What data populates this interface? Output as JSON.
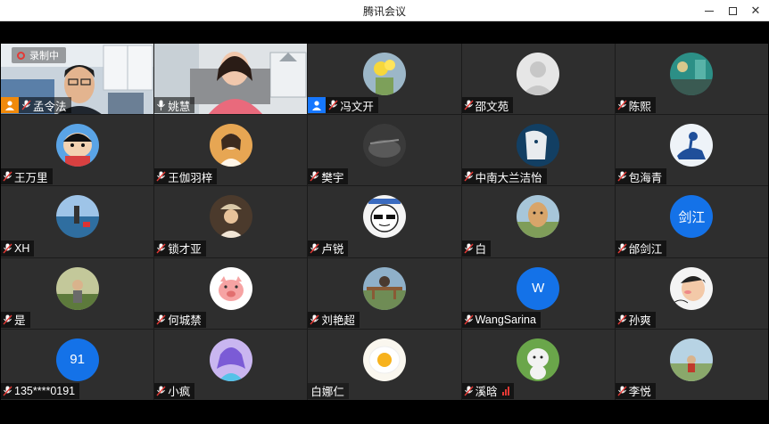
{
  "window": {
    "title": "腾讯会议",
    "minimize_icon": "minimize-icon",
    "maximize_icon": "maximize-icon",
    "close_icon": "close-icon",
    "close_glyph": "✕"
  },
  "recording": {
    "label": "录制中",
    "icon": "record-icon"
  },
  "colors": {
    "active_speaker_border": "#2fd05e",
    "host_badge": "#f08a0c",
    "cohost_badge": "#1677ff",
    "mic_muted": "#e53935",
    "text_avatar_bg": "#1472e8"
  },
  "participants": [
    {
      "name": "孟令法",
      "role": "host",
      "mic": "muted",
      "video": true
    },
    {
      "name": "姚慧",
      "mic": "on",
      "video": true,
      "active": true
    },
    {
      "name": "冯文开",
      "role": "cohost",
      "mic": "muted",
      "avatar": "daffodils-photo"
    },
    {
      "name": "邵文苑",
      "mic": "muted",
      "avatar": "default-avatar"
    },
    {
      "name": "陈熙",
      "mic": "muted",
      "avatar": "teal-scene-photo"
    },
    {
      "name": "王万里",
      "mic": "muted",
      "avatar": "cartoon-boy"
    },
    {
      "name": "王伽羽梓",
      "mic": "muted",
      "avatar": "illustrated-girl"
    },
    {
      "name": "樊宇",
      "mic": "muted",
      "avatar": "dark-photo"
    },
    {
      "name": "中南大兰洁怡",
      "mic": "muted",
      "avatar": "blue-figure-illustration"
    },
    {
      "name": "包海青",
      "mic": "muted",
      "avatar": "horse-rider-illustration"
    },
    {
      "name": "XH",
      "mic": "muted",
      "avatar": "sea-photo"
    },
    {
      "name": "锁才亚",
      "mic": "muted",
      "avatar": "person-hat-photo"
    },
    {
      "name": "卢锐",
      "mic": "muted",
      "avatar": "sunglasses-meme"
    },
    {
      "name": "白",
      "mic": "muted",
      "avatar": "alpaca-photo"
    },
    {
      "name": "邰剑江",
      "mic": "muted",
      "avatar_text": "剑江"
    },
    {
      "name": "是",
      "mic": "muted",
      "avatar": "outdoor-person-photo"
    },
    {
      "name": "何城禁",
      "mic": "muted",
      "avatar": "pig-cartoon"
    },
    {
      "name": "刘艳超",
      "mic": "muted",
      "avatar": "wood-railing-photo"
    },
    {
      "name": "WangSarina",
      "mic": "muted",
      "avatar_text": "W"
    },
    {
      "name": "孙爽",
      "mic": "muted",
      "avatar": "cartoon-kid"
    },
    {
      "name": "135****0191",
      "mic": "muted",
      "avatar_text": "91"
    },
    {
      "name": "小疯",
      "mic": "muted",
      "avatar": "anime-girl"
    },
    {
      "name": "白娜仁",
      "mic": "none",
      "avatar": "egg-yolk"
    },
    {
      "name": "溪晗",
      "mic": "muted",
      "avatar": "white-plush-toy",
      "signal": "weak"
    },
    {
      "name": "李悦",
      "mic": "muted",
      "avatar": "small-figure-photo"
    }
  ]
}
